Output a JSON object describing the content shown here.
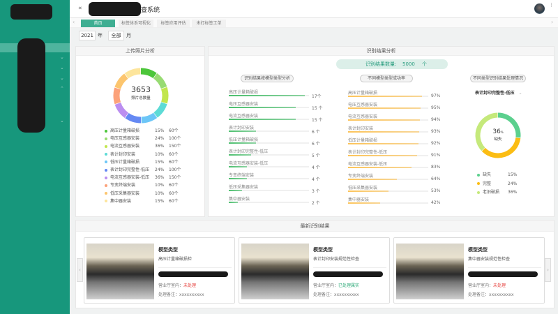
{
  "header": {
    "title_suffix": "查系统",
    "back_icon": "back-icon"
  },
  "tabs": [
    {
      "label": "首页"
    },
    {
      "label": "标签体系可视化"
    },
    {
      "label": "标签应用评估"
    },
    {
      "label": "未打标签工单"
    }
  ],
  "filter": {
    "year": "2021",
    "year_unit": "年",
    "month": "全部",
    "month_unit": "月"
  },
  "upload": {
    "title": "上传照片分析",
    "total": "3653",
    "total_label": "照片总数量",
    "items": [
      {
        "name": "高压计量箱破损",
        "pct": "15%",
        "count": "60个",
        "color": "#4cc63a"
      },
      {
        "name": "电压互感器安装",
        "pct": "24%",
        "count": "100个",
        "color": "#98db73"
      },
      {
        "name": "电流互感器安装",
        "pct": "36%",
        "count": "150个",
        "color": "#c2e64e"
      },
      {
        "name": "表计封印安装",
        "pct": "10%",
        "count": "60个",
        "color": "#5ddbd6"
      },
      {
        "name": "低压计量箱破损",
        "pct": "15%",
        "count": "60个",
        "color": "#6cc6f7"
      },
      {
        "name": "表计封印完整性-低压",
        "pct": "24%",
        "count": "100个",
        "color": "#6589f3"
      },
      {
        "name": "电流互感器安装-低压",
        "pct": "36%",
        "count": "150个",
        "color": "#bb8ef0"
      },
      {
        "name": "专变终端安装",
        "pct": "10%",
        "count": "60个",
        "color": "#fca27a"
      },
      {
        "name": "低压采集器安装",
        "pct": "10%",
        "count": "60个",
        "color": "#fcc56e"
      },
      {
        "name": "集中器安装",
        "pct": "15%",
        "count": "60个",
        "color": "#fde59c"
      }
    ]
  },
  "result": {
    "title": "识别结果分析",
    "count_label": "识别结果数量:",
    "count": "5000",
    "count_unit": "个",
    "by_model": {
      "title": "识别结果按模型类型分析",
      "color": "#4cbf6e",
      "items": [
        {
          "name": "高压计量箱破损",
          "value": 17,
          "label": "17个"
        },
        {
          "name": "电压互感器安装",
          "value": 15,
          "label": "15 个"
        },
        {
          "name": "电流互感器安装",
          "value": 15,
          "label": "15 个"
        },
        {
          "name": "表计封印安装",
          "value": 6,
          "label": "6 个"
        },
        {
          "name": "低压计量箱破损",
          "value": 6,
          "label": "6 个"
        },
        {
          "name": "表计封印完整性-低压",
          "value": 5,
          "label": "5 个"
        },
        {
          "name": "电流互感器安装-低压",
          "value": 4,
          "label": "4 个"
        },
        {
          "name": "专变终端安装",
          "value": 4,
          "label": "4 个"
        },
        {
          "name": "低压采集器安装",
          "value": 3,
          "label": "3 个"
        },
        {
          "name": "集中器安装",
          "value": 2,
          "label": "2 个"
        }
      ]
    },
    "success": {
      "title": "不同模型类型成功率",
      "color": "#fcc45a",
      "items": [
        {
          "name": "高压计量箱破损",
          "value": 97,
          "label": "97%"
        },
        {
          "name": "电压互感器安装",
          "value": 95,
          "label": "95%"
        },
        {
          "name": "电流互感器安装",
          "value": 94,
          "label": "94%"
        },
        {
          "name": "表计封印安装",
          "value": 93,
          "label": "93%"
        },
        {
          "name": "低压计量箱破损",
          "value": 92,
          "label": "92%"
        },
        {
          "name": "表计封印完整性-低压",
          "value": 91,
          "label": "91%"
        },
        {
          "name": "电流互感器安装-低压",
          "value": 83,
          "label": "83%"
        },
        {
          "name": "专变终端安装",
          "value": 64,
          "label": "64%"
        },
        {
          "name": "低压采集器安装",
          "value": 53,
          "label": "53%"
        },
        {
          "name": "集中器安装",
          "value": 42,
          "label": "42%"
        }
      ]
    },
    "handling": {
      "title": "不同类型识别结果处理情况",
      "selected": "表计封印完整性-低压",
      "center_value": "36",
      "center_unit": "%",
      "center_label": "缺失",
      "items": [
        {
          "name": "缺失",
          "pct": "15%",
          "value": 27,
          "color": "#5cd08e"
        },
        {
          "name": "完整",
          "pct": "24%",
          "value": 36,
          "color": "#fbbd14"
        },
        {
          "name": "老旧破损",
          "pct": "36%",
          "value": 37,
          "color": "#c5e97b"
        }
      ]
    }
  },
  "latest": {
    "title": "最新识别结果",
    "cards": [
      {
        "heading": "模型类型",
        "model": "高压计量箱破损检",
        "status_label": "营业厅室内：",
        "status": "未处理",
        "status_color": "#e53935",
        "note_label": "处理备注：",
        "note": "xxxxxxxxxx"
      },
      {
        "heading": "模型类型",
        "model": "表计封印安装规范性检查",
        "status_label": "营业厅室内：",
        "status": "已处理属实",
        "status_color": "#2aa876",
        "note_label": "处理备注：",
        "note": "xxxxxxxxxx"
      },
      {
        "heading": "模型类型",
        "model": "集中器安装规范性检查",
        "status_label": "营业厅室内：",
        "status": "未处理",
        "status_color": "#e53935",
        "note_label": "处理备注：",
        "note": "xxxxxxxxxx"
      }
    ]
  }
}
